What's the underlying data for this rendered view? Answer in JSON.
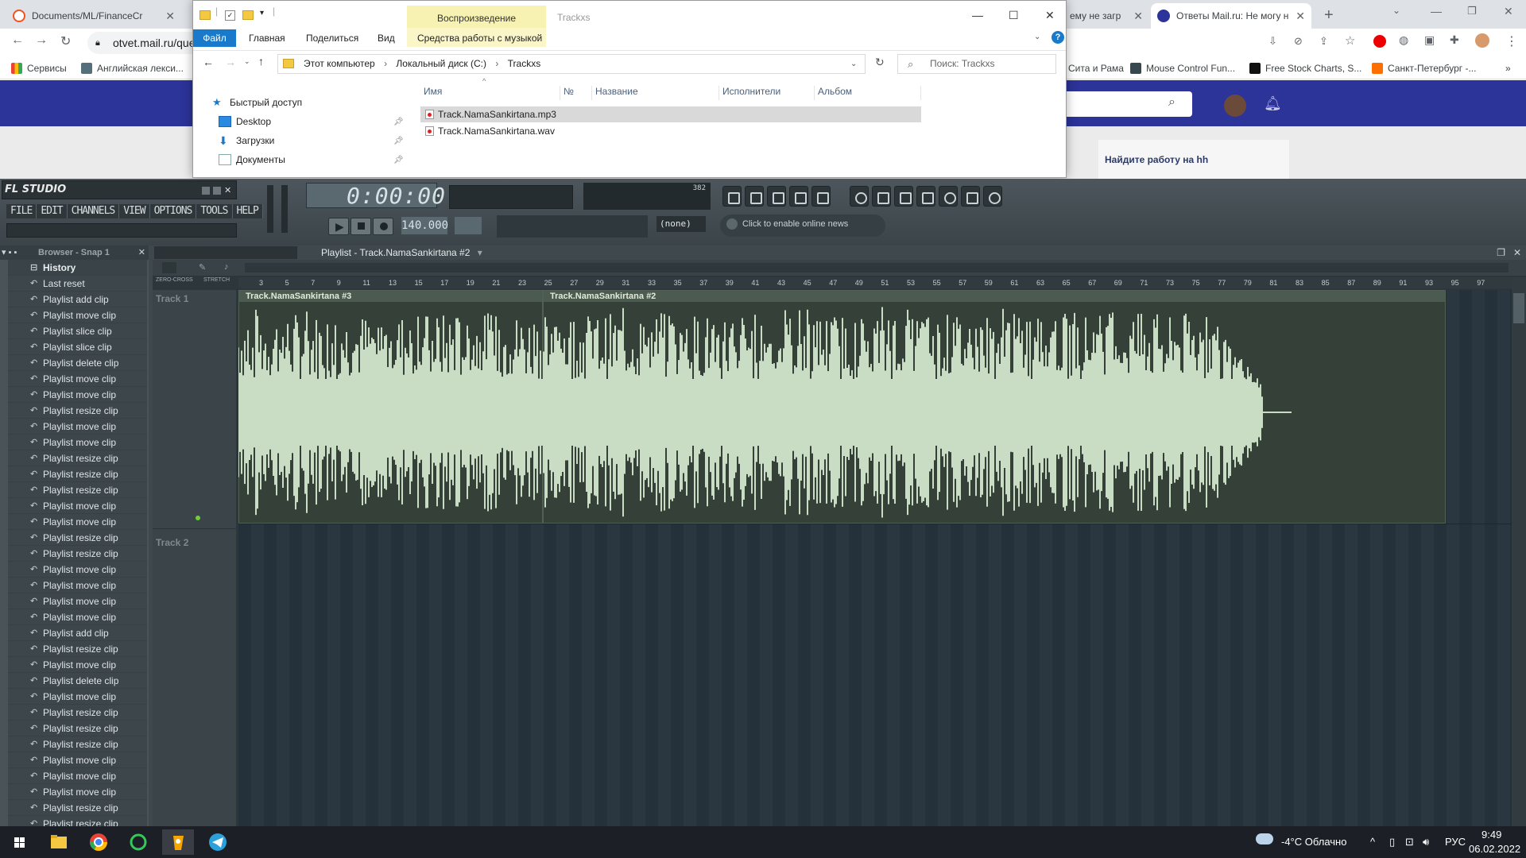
{
  "chrome": {
    "tabs": [
      {
        "title": "Documents/ML/FinanceCr",
        "favicon_color": "#f4511e"
      },
      {
        "title": "",
        "favicon_color": "#ff6d00"
      },
      {
        "title": "ему не загр",
        "favicon_color": "#9e9e9e"
      },
      {
        "title": "Ответы Mail.ru: Не могу н",
        "favicon_color": "#2c3399"
      }
    ],
    "address": "otvet.mail.ru/que",
    "bookmarks": [
      {
        "label": "Сервисы",
        "color": "#ea4335"
      },
      {
        "label": "Английская лекси...",
        "color": "#546e7a"
      },
      {
        "label": "Сита и Рама",
        "color": "#9e9e9e"
      },
      {
        "label": "Mouse Control Fun...",
        "color": "#37474f"
      },
      {
        "label": "Free Stock Charts, S...",
        "color": "#111111"
      },
      {
        "label": "Санкт-Петербург -...",
        "color": "#ff6f00"
      }
    ],
    "more": "»",
    "page_card_title": "Найдите работу на hh"
  },
  "explorer": {
    "context_tab": "Воспроизведение",
    "title": "Trackxs",
    "ribbon": {
      "file": "Файл",
      "tabs": [
        "Главная",
        "Поделиться",
        "Вид"
      ],
      "context_tab": "Средства работы с музыкой"
    },
    "breadcrumb": [
      "Этот компьютер",
      "Локальный диск (C:)",
      "Trackxs"
    ],
    "search_placeholder": "Поиск: Trackxs",
    "nav": [
      {
        "label": "Быстрый доступ",
        "icon": "star-icon"
      },
      {
        "label": "Desktop",
        "icon": "desktop-icon"
      },
      {
        "label": "Загрузки",
        "icon": "download-icon"
      },
      {
        "label": "Документы",
        "icon": "documents-icon"
      }
    ],
    "columns": [
      "Имя",
      "№",
      "Название",
      "Исполнители",
      "Альбом"
    ],
    "files": [
      {
        "name": "Track.NamaSankirtana.mp3",
        "selected": true
      },
      {
        "name": "Track.NamaSankirtana.wav",
        "selected": false
      }
    ]
  },
  "fl": {
    "logo": "FL STUDIO",
    "menu": [
      "FILE",
      "EDIT",
      "CHANNELS",
      "VIEW",
      "OPTIONS",
      "TOOLS",
      "HELP"
    ],
    "time": "0:00:00",
    "tempo": "140.000",
    "cpu_value": "382",
    "pattern": "(none)",
    "news": "Click to enable online news",
    "browser_title": "Browser - Snap 1",
    "history": [
      "History",
      "Last reset",
      "Playlist add clip",
      "Playlist move clip",
      "Playlist slice clip",
      "Playlist slice clip",
      "Playlist delete clip",
      "Playlist move clip",
      "Playlist move clip",
      "Playlist resize clip",
      "Playlist move clip",
      "Playlist move clip",
      "Playlist resize clip",
      "Playlist resize clip",
      "Playlist resize clip",
      "Playlist move clip",
      "Playlist move clip",
      "Playlist resize clip",
      "Playlist resize clip",
      "Playlist move clip",
      "Playlist move clip",
      "Playlist move clip",
      "Playlist move clip",
      "Playlist add clip",
      "Playlist resize clip",
      "Playlist move clip",
      "Playlist delete clip",
      "Playlist move clip",
      "Playlist resize clip",
      "Playlist resize clip",
      "Playlist resize clip",
      "Playlist move clip",
      "Playlist move clip",
      "Playlist move clip",
      "Playlist resize clip",
      "Playlist resize clip"
    ],
    "playlist_title": "Playlist - Track.NamaSankirtana #2",
    "tracks": [
      "Track 1",
      "Track 2"
    ],
    "clips": [
      "Track.NamaSankirtana #3",
      "Track.NamaSankirtana #2"
    ],
    "ruler": [
      "3",
      "5",
      "7",
      "9",
      "11",
      "13",
      "15",
      "17",
      "19",
      "21",
      "23",
      "25",
      "27",
      "29",
      "31",
      "33",
      "35",
      "37",
      "39",
      "41",
      "43",
      "45",
      "47",
      "49",
      "51",
      "53",
      "55",
      "57",
      "59",
      "61",
      "63",
      "65",
      "67",
      "69",
      "71",
      "73",
      "75",
      "77",
      "79",
      "81",
      "83",
      "85",
      "87",
      "89",
      "91",
      "93",
      "95",
      "97"
    ],
    "snap_labels": [
      "ZERO-CROSS",
      "STRETCH"
    ]
  },
  "taskbar": {
    "weather": "-4°C  Облачно",
    "lang": "РУС",
    "time": "9:49",
    "date": "06.02.2022"
  }
}
